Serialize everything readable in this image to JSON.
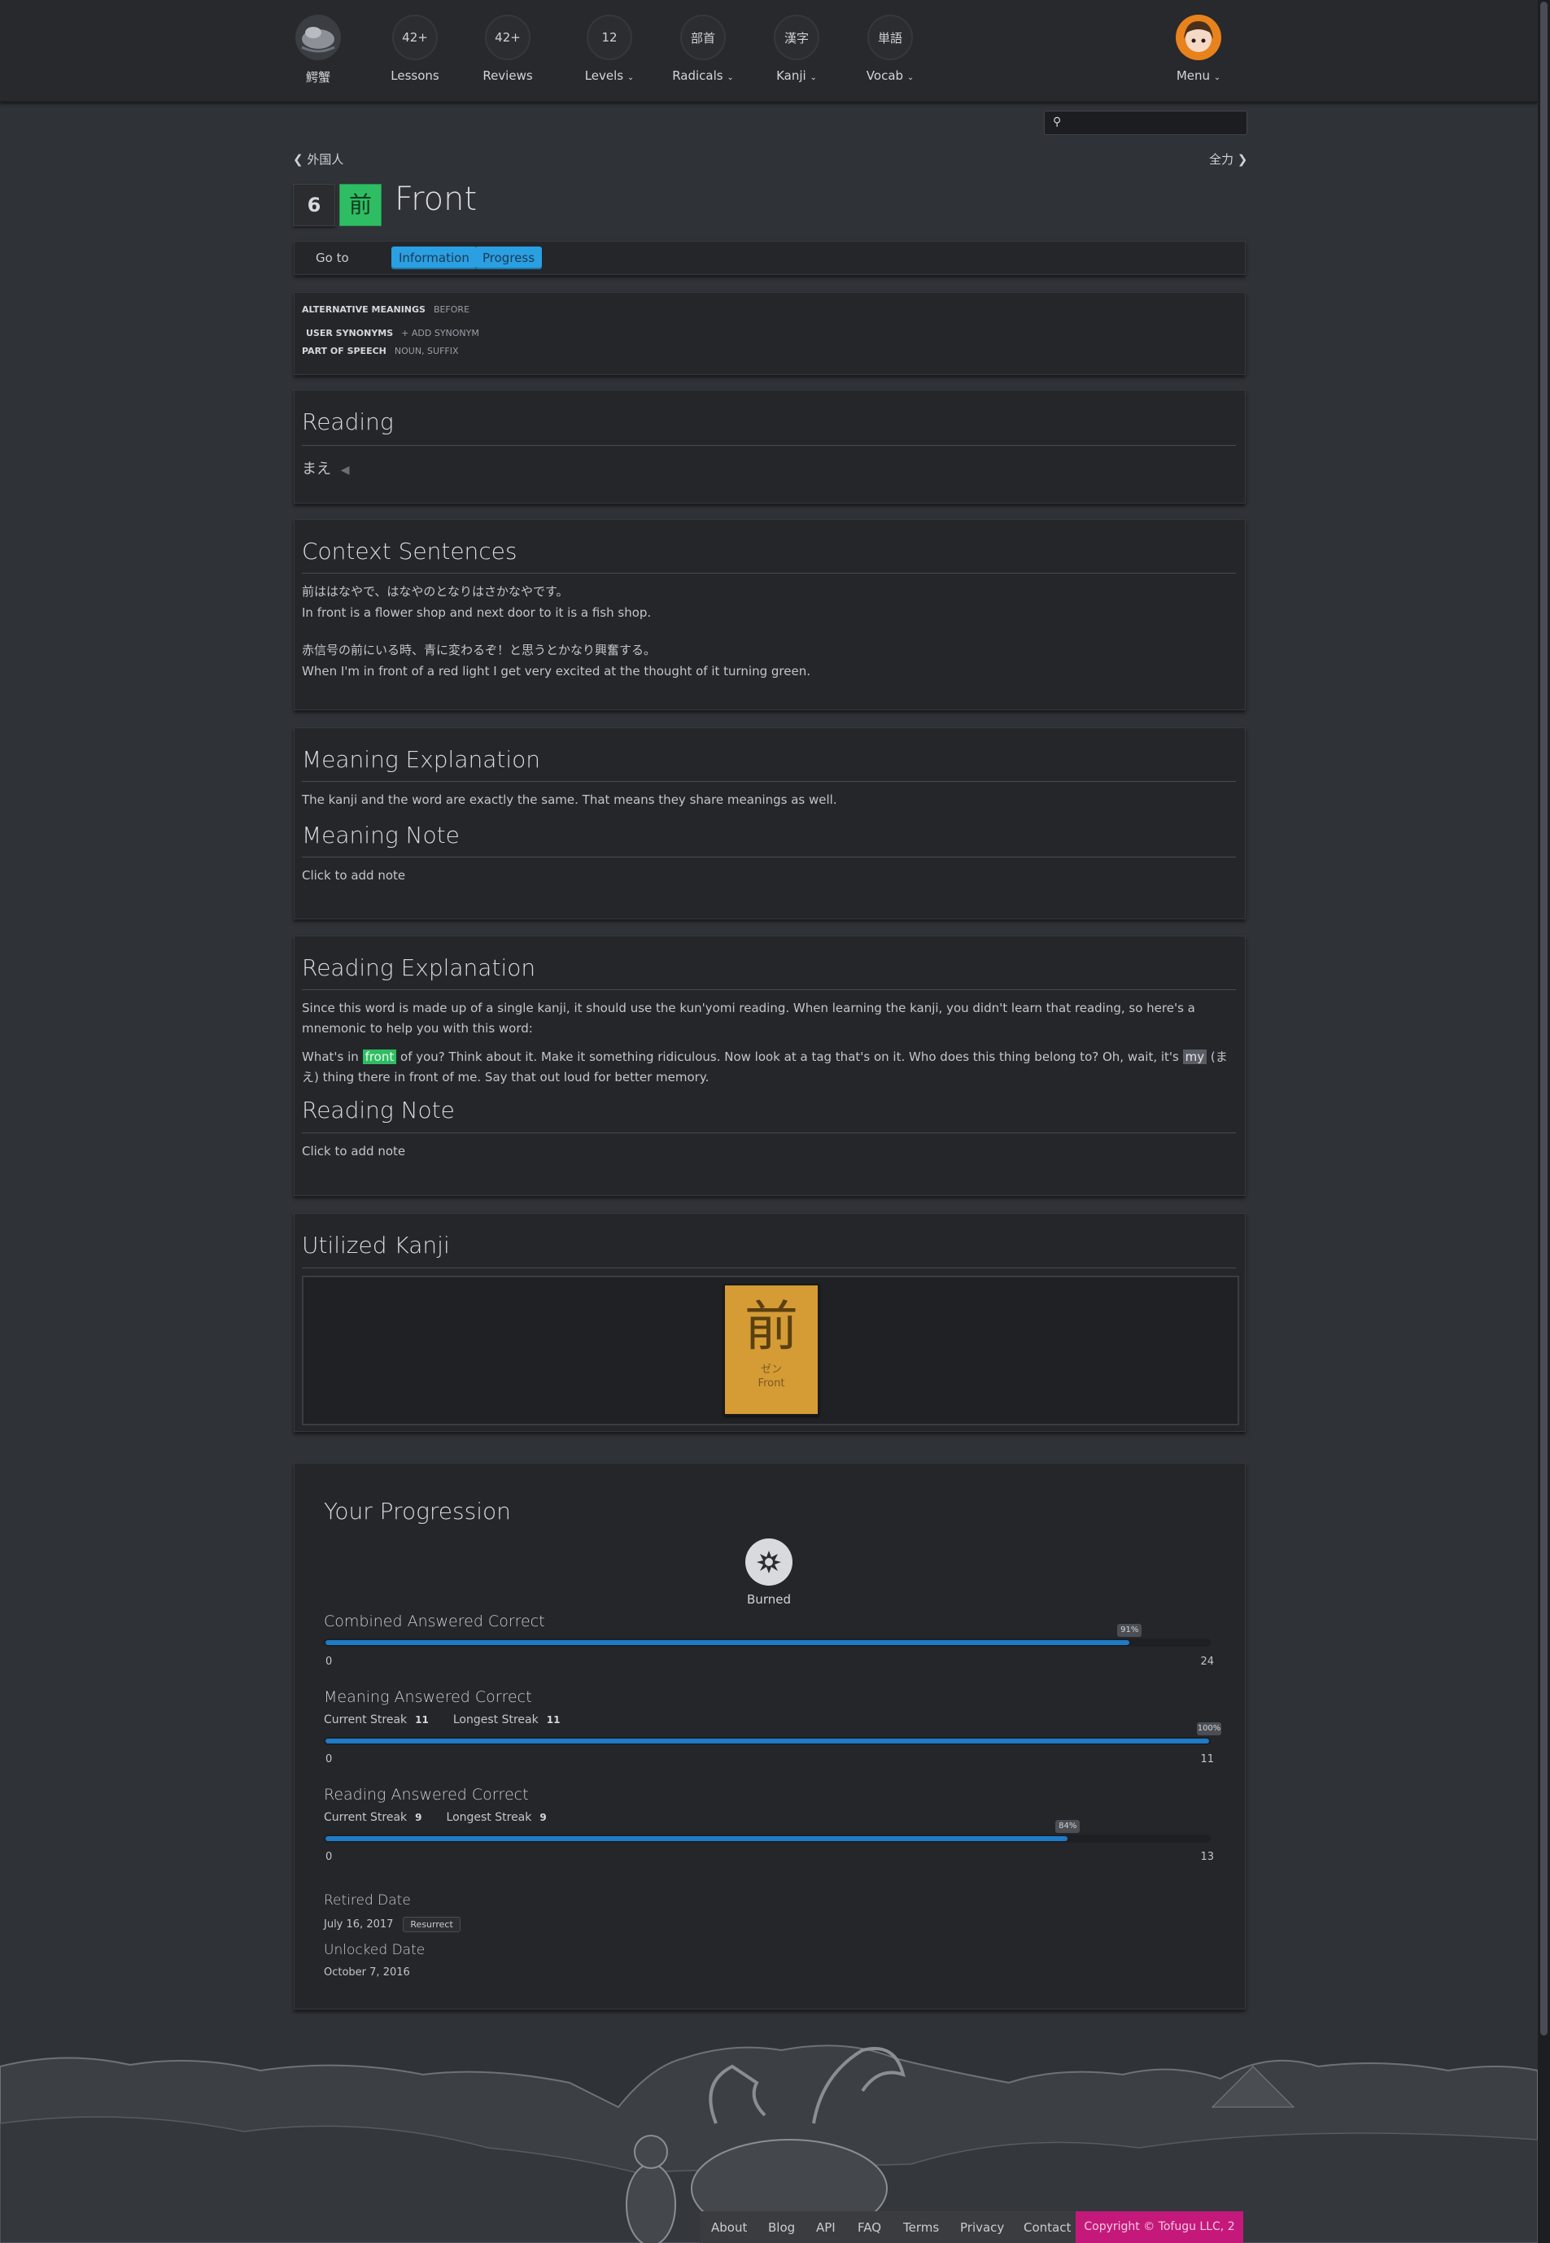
{
  "nav": {
    "logo_label": "鰐蟹",
    "lessons": {
      "count": "42+",
      "label": "Lessons"
    },
    "reviews": {
      "count": "42+",
      "label": "Reviews"
    },
    "levels": {
      "count": "12",
      "label": "Levels"
    },
    "radicals": {
      "glyph": "部首",
      "label": "Radicals"
    },
    "kanji": {
      "glyph": "漢字",
      "label": "Kanji"
    },
    "vocab": {
      "glyph": "単語",
      "label": "Vocab"
    },
    "menu_label": "Menu"
  },
  "search": {
    "placeholder": ""
  },
  "pager": {
    "prev": "外国人",
    "next": "全力"
  },
  "header": {
    "level": "6",
    "kanji": "前",
    "title": "Front"
  },
  "tabs": {
    "goto": "Go to",
    "information": "Information",
    "progress": "Progress"
  },
  "meta": {
    "alt_label": "ALTERNATIVE MEANINGS",
    "alt_value": "BEFORE",
    "syn_label": "USER SYNONYMS",
    "syn_value": "+ ADD SYNONYM",
    "pos_label": "PART OF SPEECH",
    "pos_value": "NOUN, SUFFIX"
  },
  "reading": {
    "title": "Reading",
    "value": "まえ"
  },
  "context": {
    "title": "Context Sentences",
    "s1_ja": "前ははなやで、はなやのとなりはさかなやです。",
    "s1_en": "In front is a flower shop and next door to it is a fish shop.",
    "s2_ja": "赤信号の前にいる時、青に変わるぞ！と思うとかなり興奮する。",
    "s2_en": "When I'm in front of a red light I get very excited at the thought of it turning green."
  },
  "meaning": {
    "title": "Meaning Explanation",
    "text": "The kanji and the word are exactly the same. That means they share meanings as well.",
    "note_title": "Meaning Note",
    "note_text": "Click to add note"
  },
  "reading_expl": {
    "title": "Reading Explanation",
    "p1": "Since this word is made up of a single kanji, it should use the kun'yomi reading. When learning the kanji, you didn't learn that reading, so here's a mnemonic to help you with this word:",
    "p2_a": "What's in ",
    "p2_hl1": "front",
    "p2_b": " of you? Think about it. Make it something ridiculous. Now look at a tag that's on it. Who does this thing belong to? Oh, wait, it's ",
    "p2_hl2": "my",
    "p2_c": " (まえ) thing there in front of me. Say that out loud for better memory.",
    "note_title": "Reading Note",
    "note_text": "Click to add note"
  },
  "utilized": {
    "title": "Utilized Kanji",
    "card_kanji": "前",
    "card_reading": "ゼン",
    "card_meaning": "Front"
  },
  "progression": {
    "title": "Your Progression",
    "srs_label": "Burned",
    "combined": {
      "label": "Combined Answered Correct",
      "percent": 91,
      "tip": "91%",
      "min": "0",
      "max": "24"
    },
    "meaning": {
      "label": "Meaning Answered Correct",
      "current_label": "Current Streak",
      "current": "11",
      "longest_label": "Longest Streak",
      "longest": "11",
      "percent": 100,
      "tip": "100%",
      "min": "0",
      "max": "11"
    },
    "reading": {
      "label": "Reading Answered Correct",
      "current_label": "Current Streak",
      "current": "9",
      "longest_label": "Longest Streak",
      "longest": "9",
      "percent": 84,
      "tip": "84%",
      "min": "0",
      "max": "13"
    },
    "retired_title": "Retired Date",
    "retired_date": "July 16, 2017",
    "resurrect": "Resurrect",
    "unlocked_title": "Unlocked Date",
    "unlocked_date": "October 7, 2016"
  },
  "footer": {
    "about": "About",
    "blog": "Blog",
    "api": "API",
    "faq": "FAQ",
    "terms": "Terms",
    "privacy": "Privacy",
    "contact": "Contact",
    "copyright": "Copyright © Tofugu LLC, 2"
  }
}
